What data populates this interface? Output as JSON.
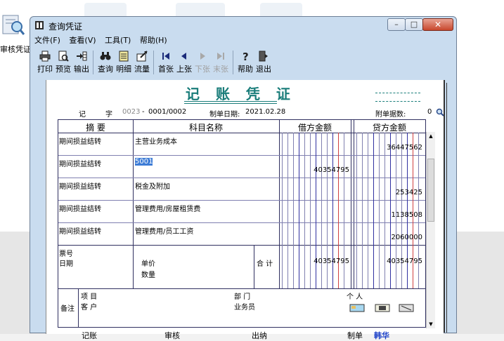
{
  "desktop": {
    "icon_label": "审核凭证"
  },
  "window": {
    "title": "查询凭证",
    "controls": {
      "minimize": "–",
      "maximize": "□",
      "close": "✕"
    }
  },
  "menu": [
    "文件(F)",
    "查看(V)",
    "工具(T)",
    "帮助(H)"
  ],
  "toolbar": [
    {
      "label": "打印",
      "icon": "printer-icon",
      "enabled": true
    },
    {
      "label": "预览",
      "icon": "preview-icon",
      "enabled": true
    },
    {
      "label": "输出",
      "icon": "export-icon",
      "enabled": true
    },
    {
      "label": "查询",
      "icon": "binoculars-icon",
      "enabled": true
    },
    {
      "label": "明细",
      "icon": "detail-icon",
      "enabled": true
    },
    {
      "label": "流量",
      "icon": "flow-icon",
      "enabled": true
    },
    {
      "label": "首张",
      "icon": "first-icon",
      "enabled": true
    },
    {
      "label": "上张",
      "icon": "prev-icon",
      "enabled": true
    },
    {
      "label": "下张",
      "icon": "next-icon",
      "enabled": false
    },
    {
      "label": "末张",
      "icon": "last-icon",
      "enabled": false
    },
    {
      "label": "帮助",
      "icon": "help-icon",
      "enabled": true
    },
    {
      "label": "退出",
      "icon": "exit-icon",
      "enabled": true
    }
  ],
  "voucher": {
    "title": "记 账 凭 证",
    "type_char": "记",
    "zi": "字",
    "number": "0023",
    "dash": "-",
    "page": "0001/0002",
    "date_label": "制单日期:",
    "date": "2021.02.28",
    "attach_label": "附单据数:",
    "attach_count": "0",
    "headers": {
      "summary": "摘 要",
      "account": "科目名称",
      "debit": "借方金额",
      "credit": "贷方金额"
    },
    "rows": [
      {
        "summary": "期间损益结转",
        "account": "主营业务成本",
        "debit": "",
        "credit": "36447562"
      },
      {
        "summary": "期间损益结转",
        "account": "5001",
        "debit": "40354795",
        "credit": ""
      },
      {
        "summary": "期间损益结转",
        "account": "税金及附加",
        "debit": "",
        "credit": "253425"
      },
      {
        "summary": "期间损益结转",
        "account": "管理费用/房屋租赁费",
        "debit": "",
        "credit": "1138508"
      },
      {
        "summary": "期间损益结转",
        "account": "管理费用/员工工资",
        "debit": "",
        "credit": "2060000"
      }
    ],
    "bottom": {
      "ticket_no": "票号",
      "date": "日期",
      "unit_price": "单价",
      "quantity": "数量",
      "total_label": "合 计",
      "total_debit": "40354795",
      "total_credit": "40354795",
      "remark": "备注",
      "project": "项 目",
      "customer": "客 户",
      "department": "部 门",
      "salesperson": "业务员",
      "person": "个 人"
    },
    "footer": {
      "bookkeeping": "记账",
      "review": "审核",
      "cashier": "出纳",
      "maker_label": "制单",
      "maker": "韩华"
    }
  },
  "colors": {
    "title": "#1a7d7a",
    "maker_name": "#1a3fc8",
    "selection": "#3d7cd6"
  }
}
